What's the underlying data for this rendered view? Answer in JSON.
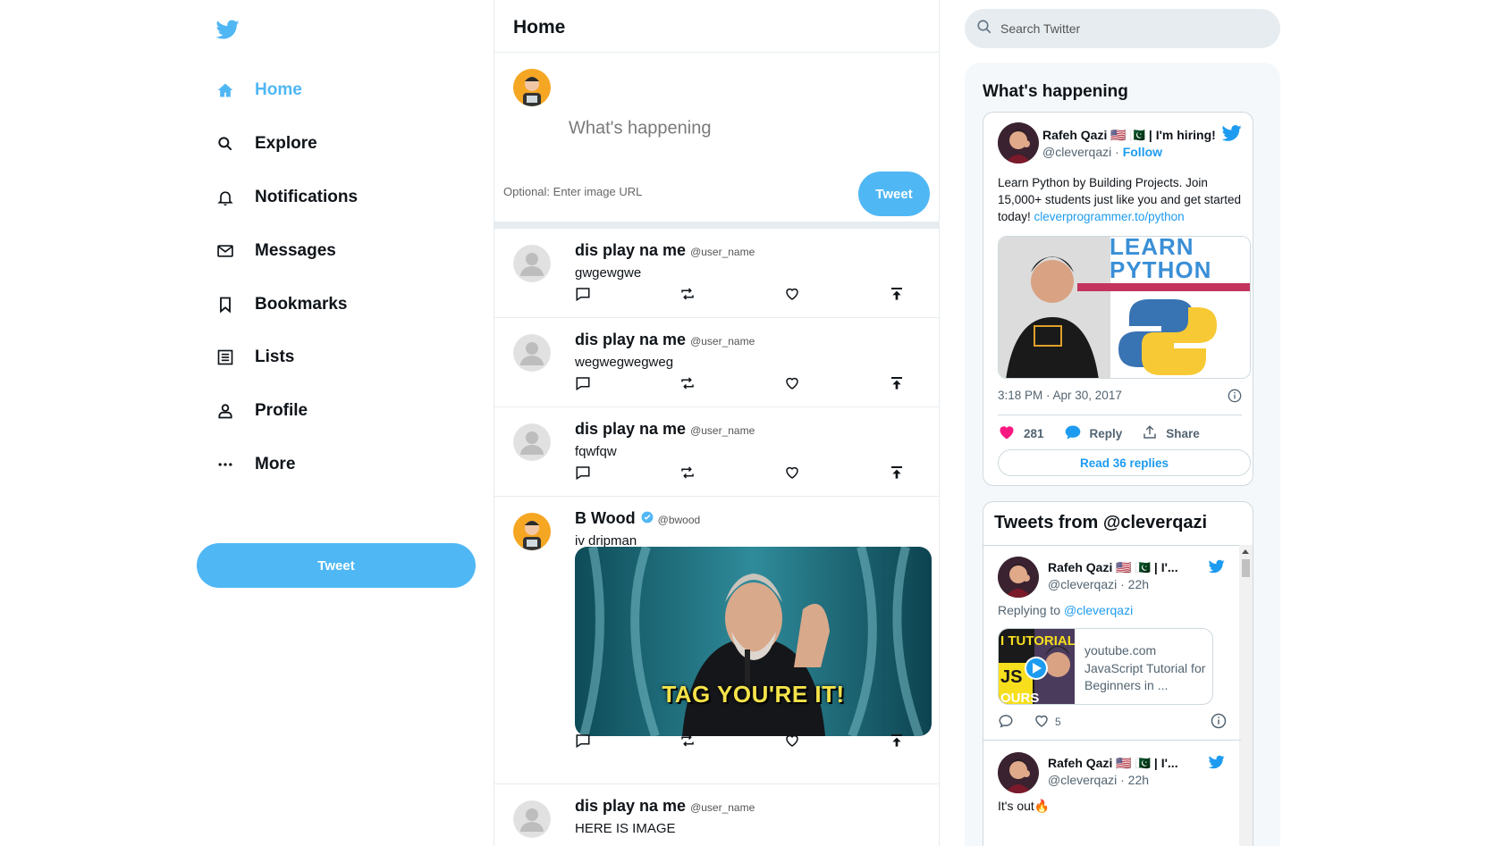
{
  "sidebar": {
    "items": [
      {
        "label": "Home",
        "icon": "home-icon",
        "active": true
      },
      {
        "label": "Explore",
        "icon": "search-icon",
        "active": false
      },
      {
        "label": "Notifications",
        "icon": "bell-icon",
        "active": false
      },
      {
        "label": "Messages",
        "icon": "mail-icon",
        "active": false
      },
      {
        "label": "Bookmarks",
        "icon": "bookmark-icon",
        "active": false
      },
      {
        "label": "Lists",
        "icon": "list-icon",
        "active": false
      },
      {
        "label": "Profile",
        "icon": "person-icon",
        "active": false
      },
      {
        "label": "More",
        "icon": "more-icon",
        "active": false
      }
    ],
    "tweet_button": "Tweet"
  },
  "feed": {
    "title": "Home",
    "compose": {
      "placeholder": "What's happening",
      "image_placeholder": "Optional: Enter image URL",
      "button": "Tweet"
    },
    "posts": [
      {
        "name": "dis play na me",
        "handle": "@user_name",
        "text": "gwgewgwe"
      },
      {
        "name": "dis play na me",
        "handle": "@user_name",
        "text": "wegwegwegweg"
      },
      {
        "name": "dis play na me",
        "handle": "@user_name",
        "text": "fqwfqw"
      },
      {
        "name": "B Wood",
        "handle": "@bwood",
        "text": "iv dripman",
        "verified": true,
        "gif_caption": "TAG YOU'RE IT!"
      },
      {
        "name": "dis play na me",
        "handle": "@user_name",
        "text": "HERE IS IMAGE"
      }
    ]
  },
  "search": {
    "placeholder": "Search Twitter"
  },
  "widgets": {
    "title": "What's happening",
    "embed": {
      "name": "Rafeh Qazi 🇺🇸 🇵🇰 | I'm hiring!",
      "handle": "@cleverqazi",
      "separator": " · ",
      "follow": "Follow",
      "text": "Learn Python by Building Projects. Join 15,000+ students just like you and get started today! ",
      "link": "cleverprogrammer.to/python",
      "image_text_1": "LEARN",
      "image_text_2": "PYTHON",
      "time": "3:18 PM · Apr 30, 2017",
      "likes": "281",
      "reply": "Reply",
      "share": "Share",
      "read_replies": "Read 36 replies"
    },
    "timeline": {
      "title": "Tweets from @cleverqazi",
      "items": [
        {
          "name": "Rafeh Qazi 🇺🇸 🇵🇰 | I'...",
          "handle": "@cleverqazi · 22h",
          "reply_prefix": "Replying to ",
          "reply_to": "@cleverqazi",
          "card_domain": "youtube.com",
          "card_title": "JavaScript Tutorial for Beginners in ...",
          "likes": "5"
        },
        {
          "name": "Rafeh Qazi 🇺🇸 🇵🇰 | I'...",
          "handle": "@cleverqazi · 22h",
          "text": "It's out🔥"
        }
      ]
    }
  },
  "colors": {
    "brand": "#50b7f5",
    "link": "#1d9bf0",
    "like": "#f91880",
    "border": "#e6ecf0"
  }
}
